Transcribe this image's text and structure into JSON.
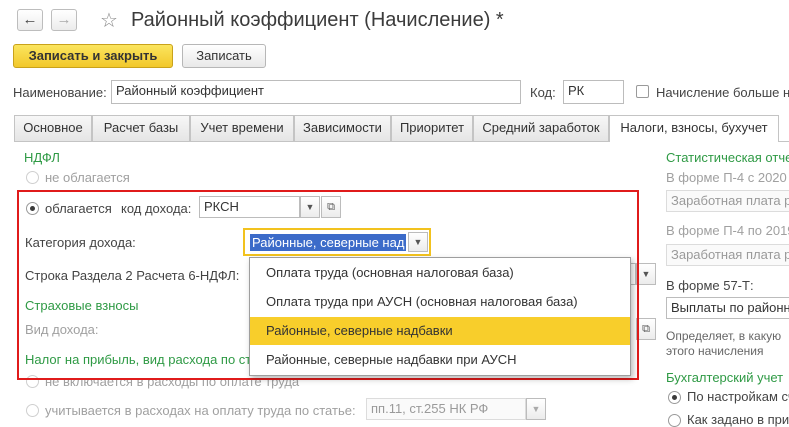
{
  "window": {
    "title": "Районный коэффициент (Начисление) *",
    "nav": {
      "back": "←",
      "forward": "→",
      "star": "☆"
    }
  },
  "toolbar": {
    "save_close": "Записать и закрыть",
    "save": "Записать"
  },
  "header": {
    "name_label": "Наименование:",
    "name_value": "Районный коэффициент",
    "code_label": "Код:",
    "code_value": "РК",
    "more_label": "Начисление больше н"
  },
  "tabs": [
    {
      "label": "Основное"
    },
    {
      "label": "Расчет базы"
    },
    {
      "label": "Учет времени"
    },
    {
      "label": "Зависимости"
    },
    {
      "label": "Приоритет"
    },
    {
      "label": "Средний заработок"
    },
    {
      "label": "Налоги, взносы, бухучет"
    }
  ],
  "ndfl": {
    "section": "НДФЛ",
    "not_taxed": "не облагается",
    "taxed": "облагается",
    "income_code_label": "код дохода:",
    "income_code_value": "РКСН",
    "category_label": "Категория дохода:",
    "category_value": "Районные, северные над",
    "row_label": "Строка Раздела 2 Расчета 6-НДФЛ:"
  },
  "dropdown": {
    "items": [
      "Оплата труда (основная налоговая база)",
      "Оплата труда при АУСН (основная налоговая база)",
      "Районные, северные надбавки",
      "Районные, северные надбавки при АУСН"
    ],
    "selected": 2
  },
  "insurance": {
    "section": "Страховые взносы",
    "income_type_label": "Вид дохода:"
  },
  "profit": {
    "section": "Налог на прибыль, вид расхода по ст",
    "not_included": "не включается в расходы по оплате труда",
    "included": "учитывается в расходах на оплату труда по статье:",
    "article_value": "пп.11, ст.255 НК РФ"
  },
  "right": {
    "stat_section": "Статистическая отче",
    "p4_2020_label": "В форме П-4 с 2020",
    "p4_2020_value": "Заработная плата ра",
    "p4_2019_label": "В форме П-4 по 2019",
    "p4_2019_value": "Заработная плата ра",
    "f57_label": "В форме 57-Т:",
    "f57_value": "Выплаты по районн",
    "note_line1": "Определяет, в какую",
    "note_line2": "этого начисления",
    "acc_section": "Бухгалтерский учет",
    "acc_option1": "По настройкам сч",
    "acc_option2": "Как задано в при"
  }
}
